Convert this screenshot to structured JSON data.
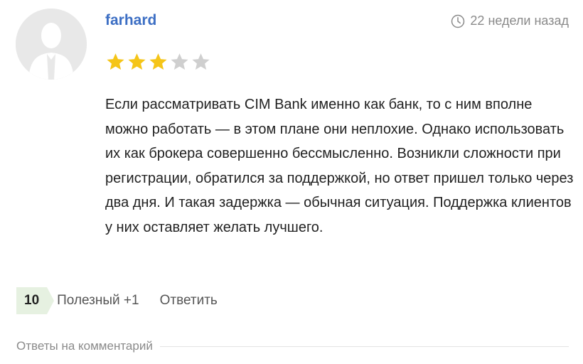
{
  "comment": {
    "author": "farhard",
    "time": "22 недели назад",
    "rating": {
      "value": 3,
      "max": 5
    },
    "text": "Если рассматривать CIM Bank именно как банк, то с ним вполне можно работать — в этом плане они неплохие. Однако использовать их как брокера совершенно бессмысленно. Возникли сложности при регистрации, обратился за поддержкой, но ответ пришел только через два дня. И такая задержка — обычная ситуация. Поддержка клиентов у них оставляет желать лучшего.",
    "score": "10",
    "helpful_label": "Полезный +1",
    "reply_label": "Ответить"
  },
  "replies": {
    "label": "Ответы на комментарий"
  },
  "colors": {
    "author": "#3d6fc4",
    "star_filled": "#f5c518",
    "star_empty": "#cfcfcf",
    "score_bg": "#e6f1e1"
  },
  "icons": {
    "avatar": "user-silhouette-icon",
    "time": "clock-icon",
    "star": "star-icon"
  }
}
